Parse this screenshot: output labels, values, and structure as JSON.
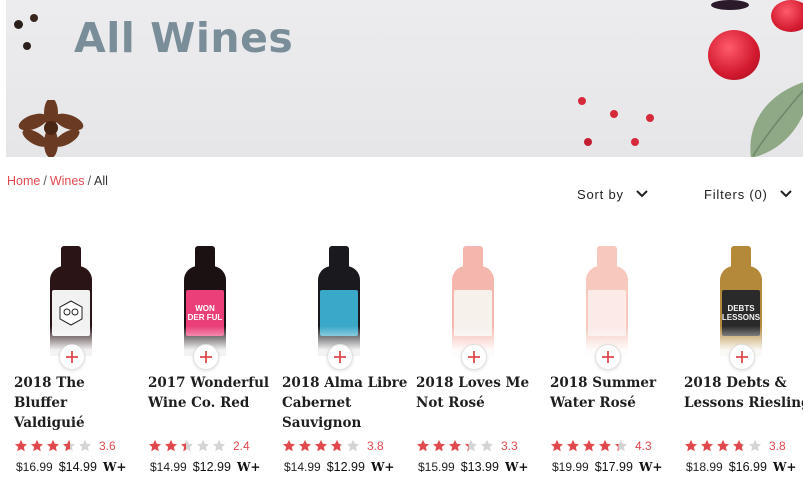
{
  "hero": {
    "title": "All Wines"
  },
  "breadcrumb": {
    "home": "Home",
    "wines": "Wines",
    "current": "All",
    "sep1": "/",
    "sep2": "/"
  },
  "controls": {
    "sort_label": "Sort by",
    "filters_label": "Filters (0)"
  },
  "colors": {
    "accent": "#e04a4f",
    "hero_title": "#7a8e9a",
    "star_empty": "#d4d4d4"
  },
  "products": [
    {
      "name": "2018 The Bluffer Valdiguié",
      "rating": "3.6",
      "rating_value": 3.6,
      "list_price": "$16.99",
      "member_price": "$14.99",
      "member_mark": "W+",
      "bottle_color": "#2a1416",
      "label_color": "#f2f2f2",
      "label_text": ""
    },
    {
      "name": "2017 Wonderful Wine Co. Red",
      "rating": "2.4",
      "rating_value": 2.4,
      "list_price": "$14.99",
      "member_price": "$12.99",
      "member_mark": "W+",
      "bottle_color": "#1b1113",
      "label_color": "#ea3f78",
      "label_text": "WON DER FUL"
    },
    {
      "name": "2018 Alma Libre Cabernet Sauvignon",
      "rating": "3.8",
      "rating_value": 3.8,
      "list_price": "$14.99",
      "member_price": "$12.99",
      "member_mark": "W+",
      "bottle_color": "#1a1a1e",
      "label_color": "#3aa8c8",
      "label_text": ""
    },
    {
      "name": "2018 Loves Me Not Rosé",
      "rating": "3.3",
      "rating_value": 3.3,
      "list_price": "$15.99",
      "member_price": "$13.99",
      "member_mark": "W+",
      "bottle_color": "#f5b7ad",
      "label_color": "#f7f1ec",
      "label_text": ""
    },
    {
      "name": "2018 Summer Water Rosé",
      "rating": "4.3",
      "rating_value": 4.3,
      "list_price": "$19.99",
      "member_price": "$17.99",
      "member_mark": "W+",
      "bottle_color": "#f7c8bd",
      "label_color": "#fbeae6",
      "label_text": ""
    },
    {
      "name": "2018 Debts & Lessons Riesling",
      "rating": "3.8",
      "rating_value": 3.8,
      "list_price": "$18.99",
      "member_price": "$16.99",
      "member_mark": "W+",
      "bottle_color": "#b48a3a",
      "label_color": "#2a2a2a",
      "label_text": "DEBTS LESSONS"
    }
  ]
}
